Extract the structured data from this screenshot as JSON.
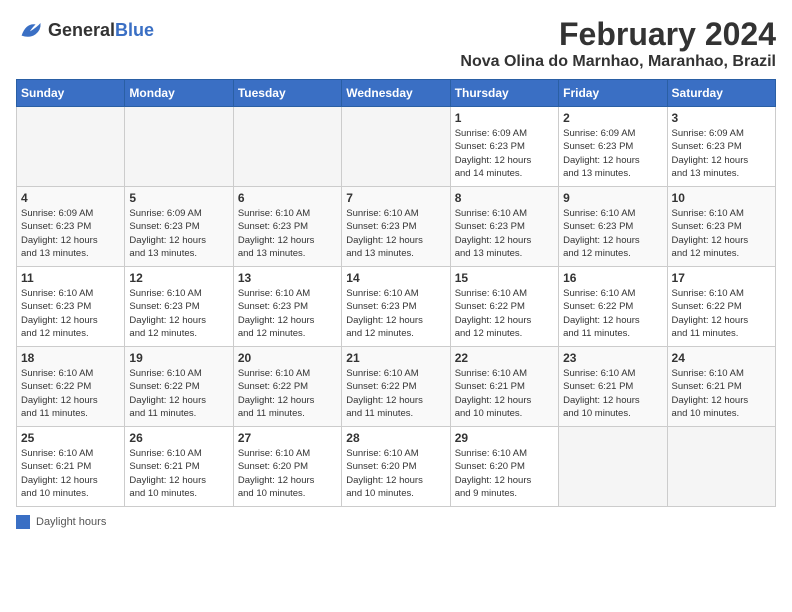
{
  "header": {
    "logo_general": "General",
    "logo_blue": "Blue",
    "month_year": "February 2024",
    "location": "Nova Olina do Marnhao, Maranhao, Brazil"
  },
  "days_of_week": [
    "Sunday",
    "Monday",
    "Tuesday",
    "Wednesday",
    "Thursday",
    "Friday",
    "Saturday"
  ],
  "footer": {
    "legend_label": "Daylight hours"
  },
  "weeks": [
    [
      {
        "day": "",
        "info": ""
      },
      {
        "day": "",
        "info": ""
      },
      {
        "day": "",
        "info": ""
      },
      {
        "day": "",
        "info": ""
      },
      {
        "day": "1",
        "info": "Sunrise: 6:09 AM\nSunset: 6:23 PM\nDaylight: 12 hours\nand 14 minutes."
      },
      {
        "day": "2",
        "info": "Sunrise: 6:09 AM\nSunset: 6:23 PM\nDaylight: 12 hours\nand 13 minutes."
      },
      {
        "day": "3",
        "info": "Sunrise: 6:09 AM\nSunset: 6:23 PM\nDaylight: 12 hours\nand 13 minutes."
      }
    ],
    [
      {
        "day": "4",
        "info": "Sunrise: 6:09 AM\nSunset: 6:23 PM\nDaylight: 12 hours\nand 13 minutes."
      },
      {
        "day": "5",
        "info": "Sunrise: 6:09 AM\nSunset: 6:23 PM\nDaylight: 12 hours\nand 13 minutes."
      },
      {
        "day": "6",
        "info": "Sunrise: 6:10 AM\nSunset: 6:23 PM\nDaylight: 12 hours\nand 13 minutes."
      },
      {
        "day": "7",
        "info": "Sunrise: 6:10 AM\nSunset: 6:23 PM\nDaylight: 12 hours\nand 13 minutes."
      },
      {
        "day": "8",
        "info": "Sunrise: 6:10 AM\nSunset: 6:23 PM\nDaylight: 12 hours\nand 13 minutes."
      },
      {
        "day": "9",
        "info": "Sunrise: 6:10 AM\nSunset: 6:23 PM\nDaylight: 12 hours\nand 12 minutes."
      },
      {
        "day": "10",
        "info": "Sunrise: 6:10 AM\nSunset: 6:23 PM\nDaylight: 12 hours\nand 12 minutes."
      }
    ],
    [
      {
        "day": "11",
        "info": "Sunrise: 6:10 AM\nSunset: 6:23 PM\nDaylight: 12 hours\nand 12 minutes."
      },
      {
        "day": "12",
        "info": "Sunrise: 6:10 AM\nSunset: 6:23 PM\nDaylight: 12 hours\nand 12 minutes."
      },
      {
        "day": "13",
        "info": "Sunrise: 6:10 AM\nSunset: 6:23 PM\nDaylight: 12 hours\nand 12 minutes."
      },
      {
        "day": "14",
        "info": "Sunrise: 6:10 AM\nSunset: 6:23 PM\nDaylight: 12 hours\nand 12 minutes."
      },
      {
        "day": "15",
        "info": "Sunrise: 6:10 AM\nSunset: 6:22 PM\nDaylight: 12 hours\nand 12 minutes."
      },
      {
        "day": "16",
        "info": "Sunrise: 6:10 AM\nSunset: 6:22 PM\nDaylight: 12 hours\nand 11 minutes."
      },
      {
        "day": "17",
        "info": "Sunrise: 6:10 AM\nSunset: 6:22 PM\nDaylight: 12 hours\nand 11 minutes."
      }
    ],
    [
      {
        "day": "18",
        "info": "Sunrise: 6:10 AM\nSunset: 6:22 PM\nDaylight: 12 hours\nand 11 minutes."
      },
      {
        "day": "19",
        "info": "Sunrise: 6:10 AM\nSunset: 6:22 PM\nDaylight: 12 hours\nand 11 minutes."
      },
      {
        "day": "20",
        "info": "Sunrise: 6:10 AM\nSunset: 6:22 PM\nDaylight: 12 hours\nand 11 minutes."
      },
      {
        "day": "21",
        "info": "Sunrise: 6:10 AM\nSunset: 6:22 PM\nDaylight: 12 hours\nand 11 minutes."
      },
      {
        "day": "22",
        "info": "Sunrise: 6:10 AM\nSunset: 6:21 PM\nDaylight: 12 hours\nand 10 minutes."
      },
      {
        "day": "23",
        "info": "Sunrise: 6:10 AM\nSunset: 6:21 PM\nDaylight: 12 hours\nand 10 minutes."
      },
      {
        "day": "24",
        "info": "Sunrise: 6:10 AM\nSunset: 6:21 PM\nDaylight: 12 hours\nand 10 minutes."
      }
    ],
    [
      {
        "day": "25",
        "info": "Sunrise: 6:10 AM\nSunset: 6:21 PM\nDaylight: 12 hours\nand 10 minutes."
      },
      {
        "day": "26",
        "info": "Sunrise: 6:10 AM\nSunset: 6:21 PM\nDaylight: 12 hours\nand 10 minutes."
      },
      {
        "day": "27",
        "info": "Sunrise: 6:10 AM\nSunset: 6:20 PM\nDaylight: 12 hours\nand 10 minutes."
      },
      {
        "day": "28",
        "info": "Sunrise: 6:10 AM\nSunset: 6:20 PM\nDaylight: 12 hours\nand 10 minutes."
      },
      {
        "day": "29",
        "info": "Sunrise: 6:10 AM\nSunset: 6:20 PM\nDaylight: 12 hours\nand 9 minutes."
      },
      {
        "day": "",
        "info": ""
      },
      {
        "day": "",
        "info": ""
      }
    ]
  ]
}
